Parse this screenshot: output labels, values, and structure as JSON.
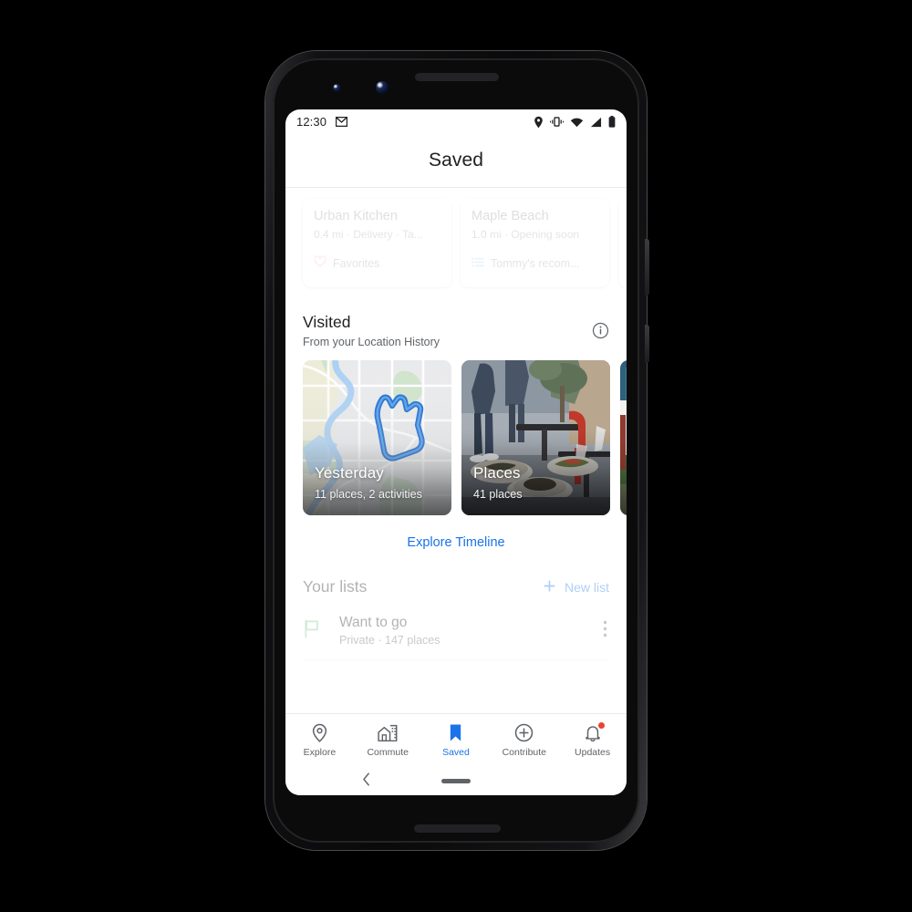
{
  "device": {
    "name": "pixel-phone"
  },
  "status_bar": {
    "time": "12:30",
    "icons": [
      "gmail-icon",
      "location-pin-icon",
      "vibrate-icon",
      "wifi-icon",
      "signal-icon",
      "battery-icon"
    ]
  },
  "header": {
    "title": "Saved"
  },
  "saved_cards": [
    {
      "name": "Urban Kitchen",
      "meta": "0.4 mi · Delivery · Ta...",
      "list_label": "Favorites",
      "list_icon": "heart-icon",
      "accent": "#f28b82"
    },
    {
      "name": "Maple Beach",
      "meta": "1.0 mi · Opening soon",
      "list_label": "Tommy's recom...",
      "list_icon": "list-icon",
      "accent": "#8ab4f8"
    }
  ],
  "visited": {
    "title": "Visited",
    "subtitle": "From your Location History",
    "info_icon": "info-icon",
    "cards": [
      {
        "title": "Yesterday",
        "subtitle": "11 places, 2 activities",
        "art": "map"
      },
      {
        "title": "Places",
        "subtitle": "41 places",
        "art": "cafe-photo"
      },
      {
        "title": "",
        "subtitle": "",
        "art": "city-photo"
      }
    ],
    "explore_link": "Explore Timeline"
  },
  "your_lists": {
    "title": "Your lists",
    "new_list_label": "New list",
    "new_list_icon": "plus-icon",
    "items": [
      {
        "name": "Want to go",
        "meta": "Private · 147 places",
        "icon": "flag-icon",
        "icon_color": "#81c995",
        "more_icon": "more-vert-icon"
      }
    ]
  },
  "bottom_nav": {
    "items": [
      {
        "label": "Explore",
        "icon": "place-pin-icon",
        "active": false,
        "badge": false
      },
      {
        "label": "Commute",
        "icon": "commute-building-icon",
        "active": false,
        "badge": false
      },
      {
        "label": "Saved",
        "icon": "bookmark-icon",
        "active": true,
        "badge": false
      },
      {
        "label": "Contribute",
        "icon": "plus-circle-icon",
        "active": false,
        "badge": false
      },
      {
        "label": "Updates",
        "icon": "bell-icon",
        "active": false,
        "badge": true
      }
    ],
    "active_color": "#1a73e8",
    "inactive_color": "#5f6368",
    "badge_color": "#ea4335"
  },
  "gesture_bar": {
    "back_icon": "chevron-left-icon",
    "home_icon": "home-pill-icon"
  },
  "colors": {
    "accent_blue": "#1a73e8",
    "text_primary": "#202124",
    "text_secondary": "#5f6368",
    "divider": "#e8eaed"
  }
}
